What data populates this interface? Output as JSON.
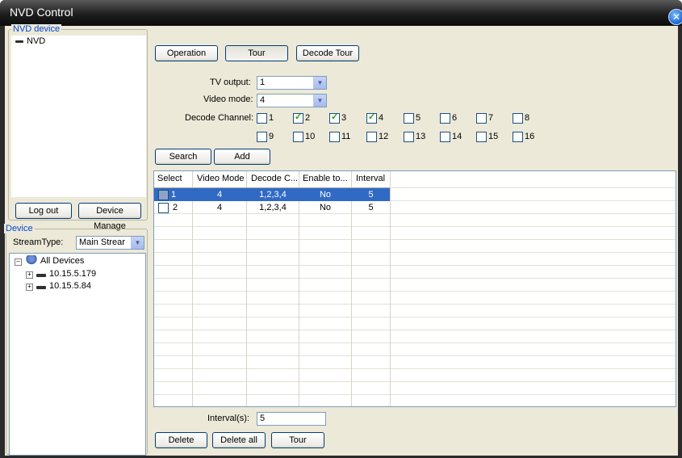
{
  "window": {
    "title": "NVD Control",
    "close_icon": "close-icon"
  },
  "nvd_device": {
    "group_label": "NVD device",
    "items": [
      {
        "label": "NVD"
      }
    ],
    "logout_label": "Log out",
    "device_manage_label": "Device Manage"
  },
  "device": {
    "group_label": "Device",
    "stream_type_label": "StreamType:",
    "stream_type_value": "Main Strear",
    "tree": {
      "root": "All Devices",
      "children": [
        "10.15.5.179",
        "10.15.5.84"
      ]
    }
  },
  "tabs": {
    "operation": "Operation",
    "tour": "Tour",
    "decode_tour": "Decode Tour"
  },
  "form": {
    "tv_output_label": "TV output:",
    "tv_output_value": "1",
    "video_mode_label": "Video mode:",
    "video_mode_value": "4",
    "decode_channel_label": "Decode Channel:",
    "channels": [
      {
        "label": "1",
        "checked": false
      },
      {
        "label": "2",
        "checked": true
      },
      {
        "label": "3",
        "checked": true
      },
      {
        "label": "4",
        "checked": true
      },
      {
        "label": "5",
        "checked": false
      },
      {
        "label": "6",
        "checked": false
      },
      {
        "label": "7",
        "checked": false
      },
      {
        "label": "8",
        "checked": false
      },
      {
        "label": "9",
        "checked": false
      },
      {
        "label": "10",
        "checked": false
      },
      {
        "label": "11",
        "checked": false
      },
      {
        "label": "12",
        "checked": false
      },
      {
        "label": "13",
        "checked": false
      },
      {
        "label": "14",
        "checked": false
      },
      {
        "label": "15",
        "checked": false
      },
      {
        "label": "16",
        "checked": false
      }
    ],
    "search_label": "Search",
    "add_label": "Add"
  },
  "table": {
    "headers": [
      "Select",
      "Video Mode",
      "Decode C...",
      "Enable to...",
      "Interval"
    ],
    "rows": [
      {
        "select": "1",
        "video_mode": "4",
        "decode": "1,2,3,4",
        "enable": "No",
        "interval": "5",
        "selected": true
      },
      {
        "select": "2",
        "video_mode": "4",
        "decode": "1,2,3,4",
        "enable": "No",
        "interval": "5",
        "selected": false
      }
    ]
  },
  "footer": {
    "interval_label": "Interval(s):",
    "interval_value": "5",
    "delete_label": "Delete",
    "delete_all_label": "Delete all",
    "tour_label": "Tour"
  }
}
